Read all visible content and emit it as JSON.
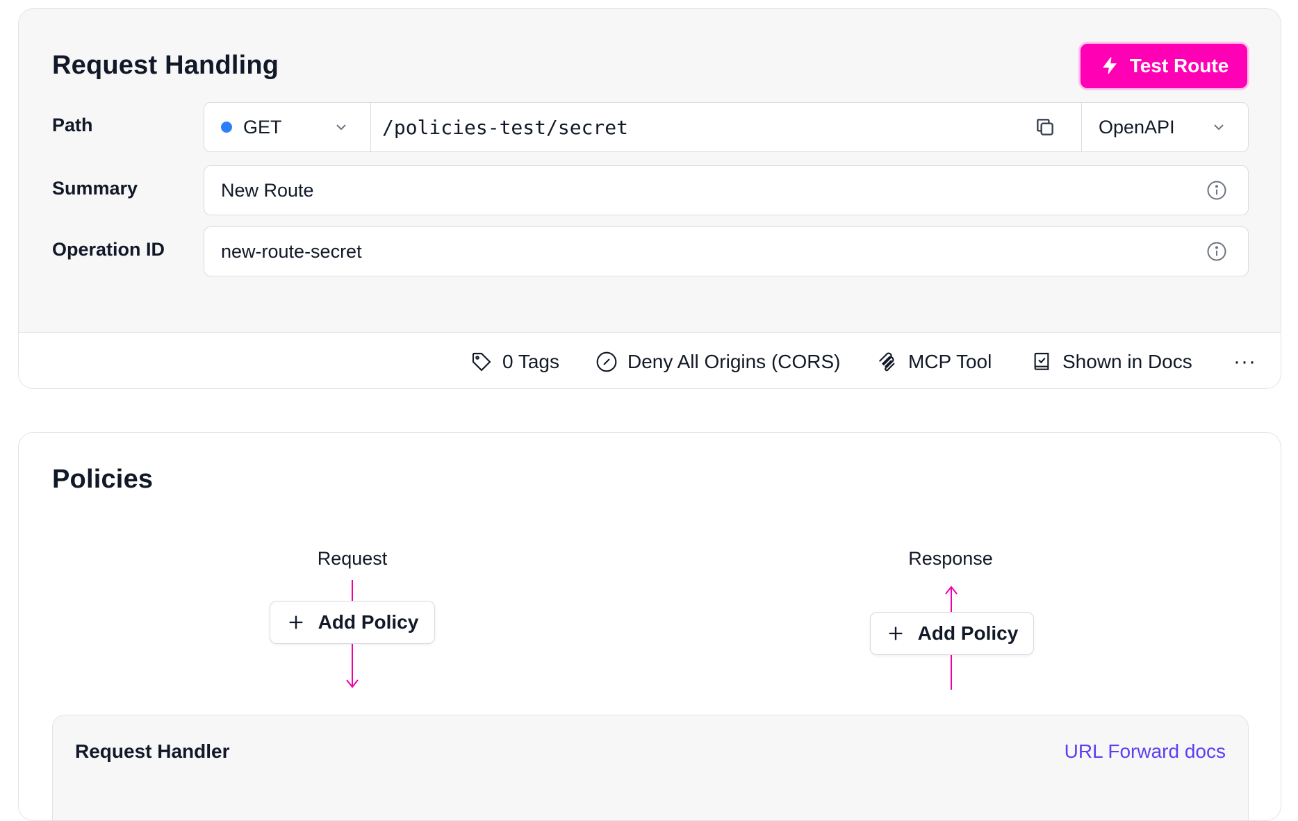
{
  "request_handling": {
    "title": "Request Handling",
    "test_route_label": "Test Route",
    "path": {
      "label": "Path",
      "method": "GET",
      "value": "/policies-test/secret",
      "spec_type": "OpenAPI"
    },
    "summary": {
      "label": "Summary",
      "value": "New Route"
    },
    "operation_id": {
      "label": "Operation ID",
      "value": "new-route-secret"
    },
    "footer": {
      "tags": "0 Tags",
      "cors": "Deny All Origins (CORS)",
      "mcp": "MCP Tool",
      "docs": "Shown in Docs",
      "more": "···"
    }
  },
  "policies": {
    "title": "Policies",
    "request_label": "Request",
    "response_label": "Response",
    "request_add_label": "Add Policy",
    "response_add_label": "Add Policy"
  },
  "request_handler": {
    "title": "Request Handler",
    "docs_link": "URL Forward docs"
  },
  "colors": {
    "accent": "#ff00b5",
    "flow_line": "#ef00a8",
    "method_dot": "#2d7ff9",
    "link": "#5a3ff0"
  },
  "icons": {
    "test_route": "lightning-bolt-icon",
    "copy": "copy-icon",
    "info": "info-icon",
    "tags": "tag-icon",
    "cors": "forbidden-circle-icon",
    "mcp": "mcp-icon",
    "docs": "book-check-icon",
    "add": "plus-icon"
  }
}
